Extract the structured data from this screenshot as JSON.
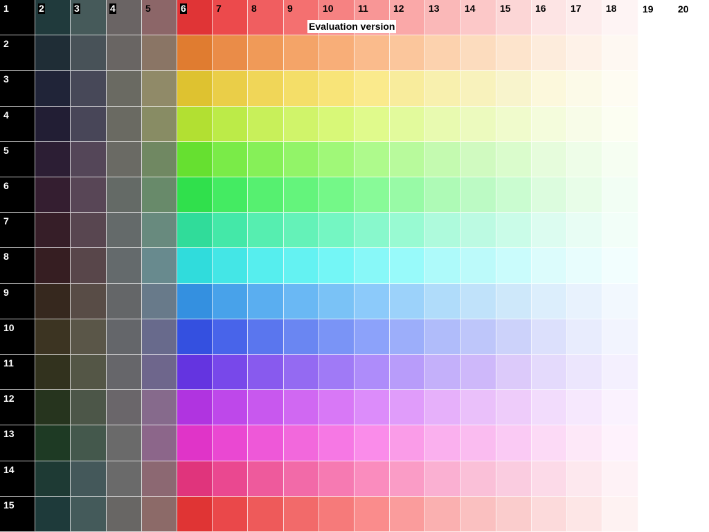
{
  "watermark": "Evaluation version",
  "column_labels": [
    "1",
    "2",
    "3",
    "4",
    "5",
    "6",
    "7",
    "8",
    "9",
    "10",
    "11",
    "12",
    "13",
    "14",
    "15",
    "16",
    "17",
    "18",
    "19",
    "20"
  ],
  "row_labels": [
    "1",
    "2",
    "3",
    "4",
    "5",
    "6",
    "7",
    "8",
    "9",
    "10",
    "11",
    "12",
    "13",
    "14",
    "15"
  ],
  "rows": [
    [
      "#000000",
      "#203a3c",
      "#465a5a",
      "#6a6464",
      "#8c6668",
      "#e03436",
      "#ec4a4c",
      "#f05e60",
      "#f47070",
      "#f68282",
      "#f89696",
      "#faa8a8",
      "#fab8b8",
      "#fcc8c8",
      "#fcd6d6",
      "#fde4e4",
      "#fdecec",
      "#fef4f4"
    ],
    [
      "#000000",
      "#1f2d36",
      "#485258",
      "#696563",
      "#8a7565",
      "#e07c30",
      "#ea8c48",
      "#f09a58",
      "#f4a468",
      "#f8ae78",
      "#fabb8c",
      "#fbc69c",
      "#fcd2ae",
      "#fcdcbe",
      "#fde4cc",
      "#fdecdc",
      "#fef2e8",
      "#fef8f2"
    ],
    [
      "#000000",
      "#202438",
      "#474858",
      "#6a6a62",
      "#908a68",
      "#dec230",
      "#eace48",
      "#f0d658",
      "#f4de68",
      "#f8e478",
      "#faea8c",
      "#f8ec9c",
      "#f8f0ae",
      "#f8f2bc",
      "#f8f4cc",
      "#fcf8dc",
      "#fcfae8",
      "#fefcf2"
    ],
    [
      "#000000",
      "#221e34",
      "#484658",
      "#6a6a62",
      "#888c64",
      "#b2e032",
      "#bceb48",
      "#c8f05a",
      "#d0f46a",
      "#d8f878",
      "#e0fa8c",
      "#e2fa9c",
      "#e8fab0",
      "#ecfabe",
      "#f0fbcc",
      "#f4fcdc",
      "#f8fce8",
      "#fcfef2"
    ],
    [
      "#000000",
      "#2c1e34",
      "#544658",
      "#6a6a64",
      "#708862",
      "#66e030",
      "#7aeb48",
      "#86f058",
      "#92f468",
      "#a0f878",
      "#aefa8c",
      "#b8fa9c",
      "#c4fab0",
      "#d0fac0",
      "#dafccc",
      "#e6fcdc",
      "#eefde8",
      "#f6fef2"
    ],
    [
      "#000000",
      "#341e30",
      "#584656",
      "#646a66",
      "#688a6a",
      "#30e04c",
      "#44eb62",
      "#56f070",
      "#64f47c",
      "#74f888",
      "#88fa98",
      "#98faa6",
      "#aefab6",
      "#bcfac4",
      "#cafcd0",
      "#dcfcde",
      "#e8fde8",
      "#f2fef4"
    ],
    [
      "#000000",
      "#361e28",
      "#584650",
      "#646a6a",
      "#688a7e",
      "#30dc9a",
      "#44e8a8",
      "#56eeb0",
      "#64f2b8",
      "#74f6c2",
      "#88f8cc",
      "#98fad2",
      "#aefadc",
      "#bcfae2",
      "#cafce8",
      "#dcfcf0",
      "#e8fdf4",
      "#f2fef8"
    ],
    [
      "#000000",
      "#361e22",
      "#58464a",
      "#646a6c",
      "#688a8e",
      "#30dcdc",
      "#44e6e6",
      "#56eeee",
      "#64f2f2",
      "#74f6f6",
      "#88f8f8",
      "#98fafa",
      "#aefafa",
      "#bcfafa",
      "#cafcfc",
      "#dcfcfc",
      "#e8fdfd",
      "#f2fefe"
    ],
    [
      "#000000",
      "#36281e",
      "#584c46",
      "#646668",
      "#687a8a",
      "#3490e0",
      "#48a2ea",
      "#5aaef0",
      "#6ab8f4",
      "#7ac2f6",
      "#8ccafa",
      "#9cd2fa",
      "#b0dcfa",
      "#c0e2fa",
      "#cee8fa",
      "#dceefc",
      "#e8f2fd",
      "#f2f8fe"
    ],
    [
      "#000000",
      "#3c3422",
      "#5a5648",
      "#64666a",
      "#686a8c",
      "#3450e0",
      "#4864ea",
      "#5a76ee",
      "#6a86f2",
      "#7a94f6",
      "#8ca2fa",
      "#9caefa",
      "#b0bcfa",
      "#bec6fa",
      "#ccd2fa",
      "#dce0fc",
      "#e8ecfd",
      "#f2f4fe"
    ],
    [
      "#000000",
      "#32321e",
      "#545646",
      "#66666a",
      "#6e668c",
      "#6434e0",
      "#7848ea",
      "#885aee",
      "#946af2",
      "#a07af6",
      "#ae8cfa",
      "#b89cfa",
      "#c4b0fa",
      "#ceb8fa",
      "#dccafa",
      "#e4dafc",
      "#ece6fd",
      "#f4f0fe"
    ],
    [
      "#000000",
      "#26341e",
      "#4c5648",
      "#6a666a",
      "#866a8c",
      "#b034e0",
      "#be48ea",
      "#c858ee",
      "#d068f2",
      "#d878f6",
      "#dc8cfa",
      "#e09cfa",
      "#e6b0fa",
      "#eac0fa",
      "#eeccfa",
      "#f2dcfc",
      "#f6e8fd",
      "#faf2fe"
    ],
    [
      "#000000",
      "#1e3a24",
      "#44584c",
      "#6a6a6a",
      "#8c668a",
      "#e034c8",
      "#ea48d2",
      "#ee58d8",
      "#f268dc",
      "#f678e4",
      "#fa8cea",
      "#fa9ce8",
      "#fab0ee",
      "#fabcf0",
      "#facaf4",
      "#fcdaf6",
      "#fde8f8",
      "#fef2fc"
    ],
    [
      "#000000",
      "#1e3a34",
      "#44585a",
      "#6a6a6a",
      "#8c6872",
      "#e0347c",
      "#ea4890",
      "#ee5a9c",
      "#f26aa8",
      "#f67ab2",
      "#fa8cbe",
      "#fa9cc6",
      "#fab0d2",
      "#fac0d8",
      "#facce0",
      "#fcdae8",
      "#fde8ee",
      "#fef2f6"
    ],
    [
      "#000000",
      "#1e3a3a",
      "#445a5a",
      "#686664",
      "#8c6a68",
      "#e03434",
      "#ea484a",
      "#ee5a5a",
      "#f26a6a",
      "#f67a7a",
      "#fa8c8c",
      "#fa9c9c",
      "#fab0b0",
      "#fac0c0",
      "#facccc",
      "#fcdadb",
      "#fde6e6",
      "#fef2f2"
    ]
  ]
}
